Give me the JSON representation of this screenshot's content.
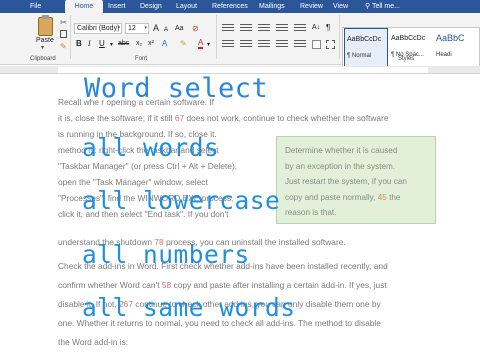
{
  "tabs": [
    "File",
    "Home",
    "Insert",
    "Design",
    "Layout",
    "References",
    "Mailings",
    "Review",
    "View"
  ],
  "tell_me": "Tell me...",
  "ribbon": {
    "paste_label": "Paste",
    "clipboard_label": "Clipboard",
    "font_name": "Calibri (Body)",
    "font_size": "12",
    "font_label": "Font",
    "styles_label": "Styles",
    "bold": "B",
    "italic": "I",
    "underline": "U",
    "grow": "A",
    "shrink": "A",
    "aa": "Aa",
    "font_color": "A",
    "styles": [
      {
        "sample": "AaBbCcDc",
        "name": "¶ Normal"
      },
      {
        "sample": "AaBbCcDc",
        "name": "¶ No Spac..."
      },
      {
        "sample": "AaBbC",
        "name": "Headi"
      }
    ]
  },
  "document": {
    "lines": [
      {
        "pre": "Recall whe",
        "num": "",
        "post": "                                                           r opening a certain software. If"
      },
      {
        "pre": "it is, close the software; if it still ",
        "num": "67",
        "post": " does not work, continue to check whether the software"
      },
      {
        "pre": "is running in the background. If so, close it.",
        "num": "",
        "post": ""
      },
      {
        "pre": "method is: right-click the taskbar and select",
        "num": "",
        "post": ""
      },
      {
        "pre": "\"Taskbar Manager\" (or press Ctrl + Alt + Delete),",
        "num": "",
        "post": ""
      },
      {
        "pre": "open the \"Task Manager\" window, select",
        "num": "",
        "post": ""
      },
      {
        "pre": "\"Processes\", find the WINWORD.EXE process,",
        "num": "",
        "post": ""
      },
      {
        "pre": "click it, and then select \"End task\". If you don't",
        "num": "",
        "post": ""
      },
      {
        "pre": "understand the shutdown ",
        "num": "78",
        "post": " process, you can uninstall the installed software."
      },
      {
        "pre": "Check the add-ins in Word. First check whether add-ins have been installed recently, and",
        "num": "",
        "post": ""
      },
      {
        "pre": "confirm whether Word can't ",
        "num": "58",
        "post": " copy and paste after installing a certain add-in. If yes, just"
      },
      {
        "pre": "disable it. If not, ",
        "num": "267",
        "post": " continue to check other add-ins, you can only disable them one by"
      },
      {
        "pre": "one. Whether it returns to normal, you need to check all add-ins. The method to disable",
        "num": "",
        "post": ""
      },
      {
        "pre": "the Word add-in is:",
        "num": "",
        "post": ""
      }
    ],
    "callout": [
      {
        "pre": "Determine whether it is caused",
        "num": "",
        "post": ""
      },
      {
        "pre": "by an exception in the system.",
        "num": "",
        "post": ""
      },
      {
        "pre": "Just restart the system, if you can",
        "num": "",
        "post": ""
      },
      {
        "pre": "copy and paste normally, ",
        "num": "45",
        "post": " the"
      },
      {
        "pre": "reason is that.",
        "num": "",
        "post": ""
      }
    ]
  },
  "overlay": {
    "title": "Word select",
    "items": [
      "all words",
      "all lowercase",
      "all numbers",
      "all same words"
    ]
  },
  "colors": {
    "ribbon_tab_bar": "#2b579a",
    "overlay_text": "#1f8fe0",
    "callout_bg": "#e2efd9",
    "number_highlight": "#e07070"
  }
}
